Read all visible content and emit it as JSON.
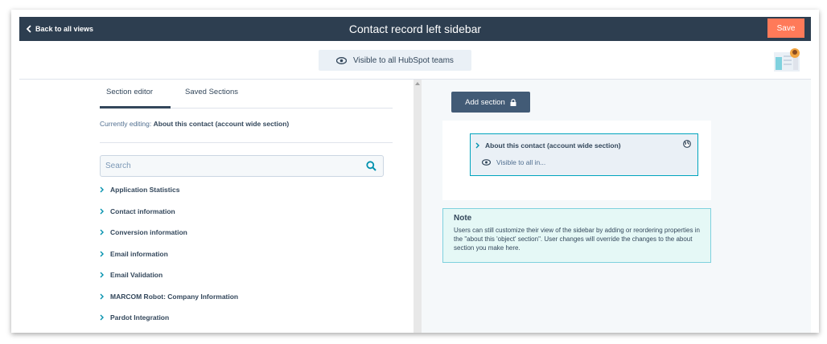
{
  "header": {
    "back_label": "Back to all views",
    "title": "Contact record left sidebar",
    "save_label": "Save"
  },
  "visibility": {
    "label": "Visible to all HubSpot teams"
  },
  "left_panel": {
    "tabs": [
      {
        "label": "Section editor",
        "active": true
      },
      {
        "label": "Saved Sections",
        "active": false
      }
    ],
    "editing_prefix": "Currently editing: ",
    "editing_section": "About this contact (account wide section)",
    "search_placeholder": "Search",
    "groups": [
      "Application Statistics",
      "Contact information",
      "Conversion information",
      "Email information",
      "Email Validation",
      "MARCOM Robot: Company Information",
      "Pardot Integration"
    ]
  },
  "right_panel": {
    "add_section_label": "Add section",
    "section": {
      "title": "About this contact (account wide section)",
      "visibility": "Visible to all in..."
    },
    "note": {
      "title": "Note",
      "body": "Users can still customize their view of the sidebar by adding or reordering properties in the \"about this 'object' section\". User changes will override the changes to the about section you make here."
    }
  },
  "colors": {
    "topbar": "#2d3e50",
    "save": "#ff7a59",
    "button_dark": "#425b76",
    "accent_teal": "#00a4bd",
    "note_bg": "#e5f8f6"
  },
  "icons": {
    "back": "chevron-left-icon",
    "visibility": "eye-icon",
    "search": "search-icon",
    "lock": "lock-icon",
    "globe": "globe-icon",
    "expand": "chevron-right-icon"
  }
}
